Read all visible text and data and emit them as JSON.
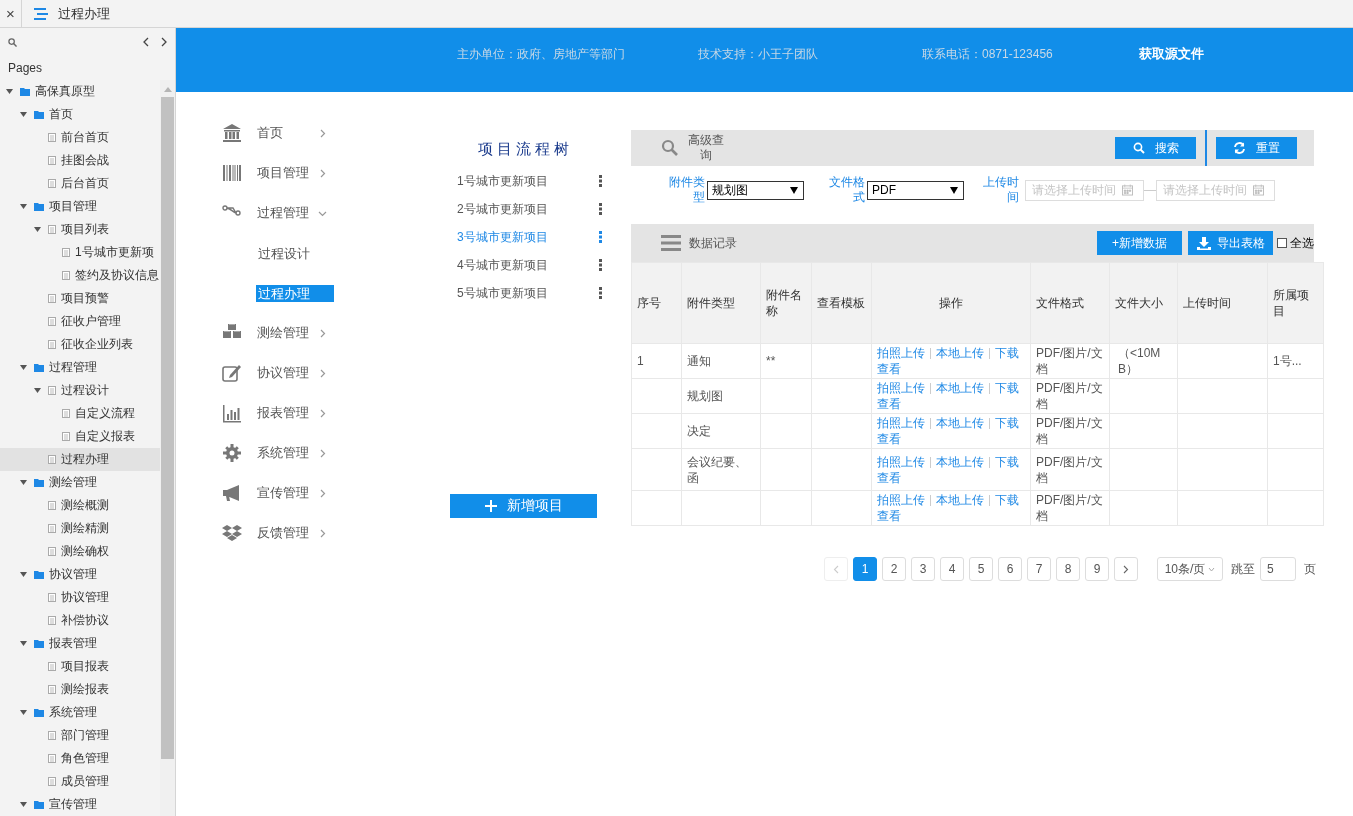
{
  "topbar": {
    "close": "×",
    "title": "过程办理"
  },
  "pages": {
    "label": "Pages",
    "tree": [
      {
        "label": "高保真原型",
        "kind": "folder",
        "expanded": true,
        "selected": false,
        "children": [
          {
            "label": "首页",
            "kind": "folder",
            "expanded": true,
            "selected": false,
            "children": [
              {
                "label": "前台首页",
                "kind": "page",
                "selected": false
              },
              {
                "label": "挂图会战",
                "kind": "page",
                "selected": false
              },
              {
                "label": "后台首页",
                "kind": "page",
                "selected": false
              }
            ]
          },
          {
            "label": "项目管理",
            "kind": "folder",
            "expanded": true,
            "selected": false,
            "children": [
              {
                "label": "项目列表",
                "kind": "page",
                "expanded": true,
                "selected": false,
                "children": [
                  {
                    "label": "1号城市更新项",
                    "kind": "page",
                    "selected": false
                  },
                  {
                    "label": "签约及协议信息",
                    "kind": "page",
                    "selected": false
                  }
                ]
              },
              {
                "label": "项目预警",
                "kind": "page",
                "selected": false
              },
              {
                "label": "征收户管理",
                "kind": "page",
                "selected": false
              },
              {
                "label": "征收企业列表",
                "kind": "page",
                "selected": false
              }
            ]
          },
          {
            "label": "过程管理",
            "kind": "folder",
            "expanded": true,
            "selected": false,
            "children": [
              {
                "label": "过程设计",
                "kind": "page",
                "expanded": true,
                "selected": false,
                "children": [
                  {
                    "label": "自定义流程",
                    "kind": "page",
                    "selected": false
                  },
                  {
                    "label": "自定义报表",
                    "kind": "page",
                    "selected": false
                  }
                ]
              },
              {
                "label": "过程办理",
                "kind": "page",
                "selected": true
              }
            ]
          },
          {
            "label": "测绘管理",
            "kind": "folder",
            "expanded": true,
            "selected": false,
            "children": [
              {
                "label": "测绘概测",
                "kind": "page",
                "selected": false
              },
              {
                "label": "测绘精测",
                "kind": "page",
                "selected": false
              },
              {
                "label": "测绘确权",
                "kind": "page",
                "selected": false
              }
            ]
          },
          {
            "label": "协议管理",
            "kind": "folder",
            "expanded": true,
            "selected": false,
            "children": [
              {
                "label": "协议管理",
                "kind": "page",
                "selected": false
              },
              {
                "label": "补偿协议",
                "kind": "page",
                "selected": false
              }
            ]
          },
          {
            "label": "报表管理",
            "kind": "folder",
            "expanded": true,
            "selected": false,
            "children": [
              {
                "label": "项目报表",
                "kind": "page",
                "selected": false
              },
              {
                "label": "测绘报表",
                "kind": "page",
                "selected": false
              }
            ]
          },
          {
            "label": "系统管理",
            "kind": "folder",
            "expanded": true,
            "selected": false,
            "children": [
              {
                "label": "部门管理",
                "kind": "page",
                "selected": false
              },
              {
                "label": "角色管理",
                "kind": "page",
                "selected": false
              },
              {
                "label": "成员管理",
                "kind": "page",
                "selected": false
              }
            ]
          },
          {
            "label": "宣传管理",
            "kind": "folder",
            "expanded": true,
            "selected": false
          }
        ]
      }
    ]
  },
  "header": {
    "items": [
      "主办单位：政府、房地产等部门",
      "技术支持：小王子团队",
      "联系电话：0871-123456"
    ],
    "source_link": "获取源文件"
  },
  "nav": [
    {
      "label": "首页",
      "expanded": false
    },
    {
      "label": "项目管理",
      "expanded": false
    },
    {
      "label": "过程管理",
      "expanded": true,
      "children": [
        {
          "label": "过程设计",
          "selected": false
        },
        {
          "label": "过程办理",
          "selected": true
        }
      ]
    },
    {
      "label": "测绘管理",
      "expanded": false
    },
    {
      "label": "协议管理",
      "expanded": false
    },
    {
      "label": "报表管理",
      "expanded": false
    },
    {
      "label": "系统管理",
      "expanded": false
    },
    {
      "label": "宣传管理",
      "expanded": false
    },
    {
      "label": "反馈管理",
      "expanded": false
    }
  ],
  "project_tree": {
    "title": "项目流程树",
    "items": [
      {
        "label": "1号城市更新项目",
        "selected": false
      },
      {
        "label": "2号城市更新项目",
        "selected": false
      },
      {
        "label": "3号城市更新项目",
        "selected": true
      },
      {
        "label": "4号城市更新项目",
        "selected": false
      },
      {
        "label": "5号城市更新项目",
        "selected": false
      }
    ],
    "add_button": "新增项目"
  },
  "search_bar": {
    "title": "高级查询",
    "search_button": "搜索",
    "reset_button": "重置"
  },
  "filters": [
    {
      "kind": "select",
      "label": "附件类型",
      "value": "规划图"
    },
    {
      "kind": "select",
      "label": "文件格式",
      "value": "PDF"
    },
    {
      "kind": "date_range",
      "label": "上传时间",
      "start": {
        "placeholder": "请选择上传时间"
      },
      "end": {
        "placeholder": "请选择上传时间"
      }
    }
  ],
  "records_bar": {
    "title": "数据记录",
    "add_button": "+新增数据",
    "export_button": "导出表格",
    "select_all": {
      "label": "全选",
      "checked": false
    }
  },
  "table": {
    "columns": [
      "序号",
      "附件类型",
      "附件名称",
      "查看模板",
      "操作",
      "文件格式",
      "文件大小",
      "上传时间",
      "所属项目"
    ],
    "rows": [
      {
        "index": "1",
        "type": "通知",
        "name": "**",
        "actions": [
          "拍照上传",
          "本地上传",
          "下载",
          "查看"
        ],
        "format": "PDF/图片/文档",
        "size": "（<10MB）",
        "project": "1号..."
      },
      {
        "type": "规划图",
        "actions": [
          "拍照上传",
          "本地上传",
          "下载",
          "查看"
        ],
        "format": "PDF/图片/文档"
      },
      {
        "type": "决定",
        "actions": [
          "拍照上传",
          "本地上传",
          "下载",
          "查看"
        ],
        "format": "PDF/图片/文档"
      },
      {
        "type": "会议纪要、函",
        "actions": [
          "拍照上传",
          "本地上传",
          "下载",
          "查看"
        ],
        "format": "PDF/图片/文档"
      },
      {
        "actions": [
          "拍照上传",
          "本地上传",
          "下载",
          "查看"
        ],
        "format": "PDF/图片/文档"
      }
    ]
  },
  "pagination": {
    "prev": {
      "disabled": true
    },
    "pages": [
      {
        "label": "1",
        "selected": true
      },
      {
        "label": "2",
        "selected": false
      },
      {
        "label": "3",
        "selected": false
      },
      {
        "label": "4",
        "selected": false
      },
      {
        "label": "5",
        "selected": false
      },
      {
        "label": "6",
        "selected": false
      },
      {
        "label": "7",
        "selected": false
      },
      {
        "label": "8",
        "selected": false
      },
      {
        "label": "9",
        "selected": false
      }
    ],
    "next": {
      "disabled": false
    },
    "page_size": "10条/页",
    "jump_label": "跳至",
    "jump_value": "5",
    "page_unit": "页"
  }
}
